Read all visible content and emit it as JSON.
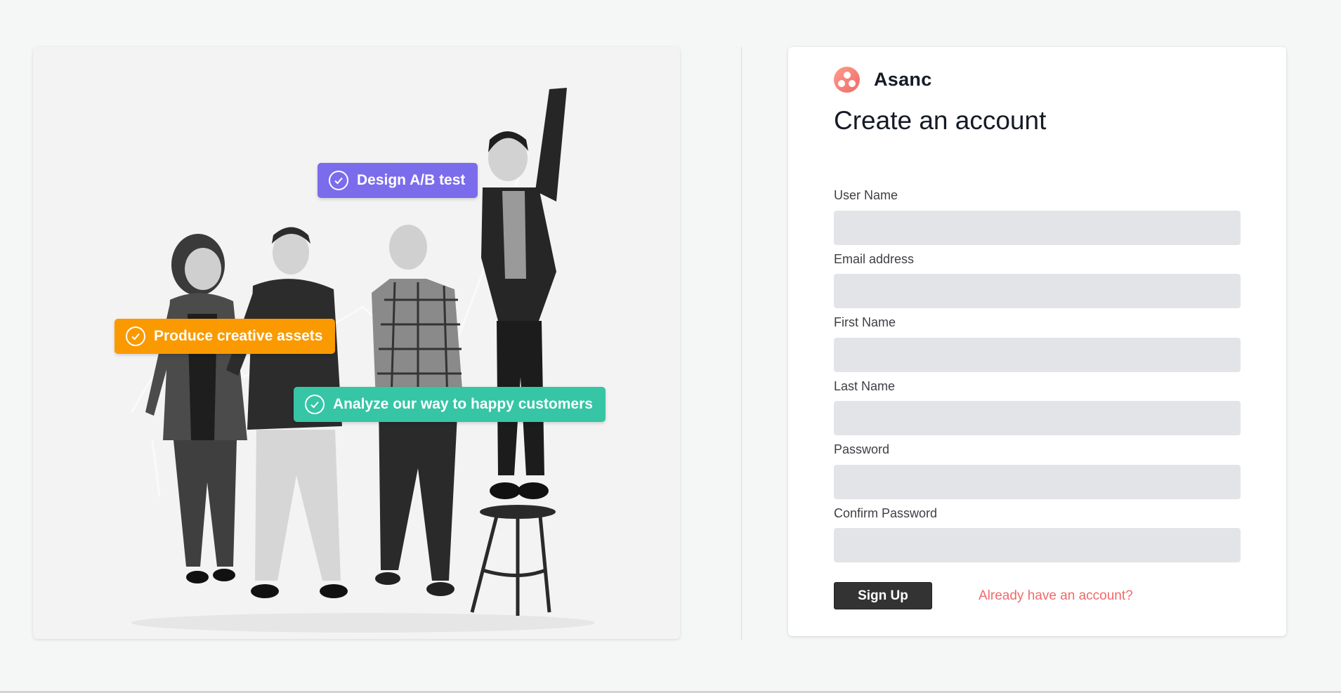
{
  "hero": {
    "tasks": [
      {
        "label": "Design A/B test",
        "color": "#7b6cec"
      },
      {
        "label": "Produce creative assets",
        "color": "#fa9a00"
      },
      {
        "label": "Analyze our way to happy customers",
        "color": "#36c5a5"
      }
    ]
  },
  "brand": {
    "name": "Asanc",
    "logo_icon": "three-dots-logo-icon",
    "accent": "#f06a6a"
  },
  "form": {
    "title": "Create an account",
    "fields": [
      {
        "label": "User Name",
        "value": ""
      },
      {
        "label": "Email address",
        "value": ""
      },
      {
        "label": "First Name",
        "value": ""
      },
      {
        "label": "Last Name",
        "value": ""
      },
      {
        "label": "Password",
        "value": ""
      },
      {
        "label": "Confirm Password",
        "value": ""
      }
    ],
    "submit_label": "Sign Up",
    "login_link": "Already have an account?"
  }
}
